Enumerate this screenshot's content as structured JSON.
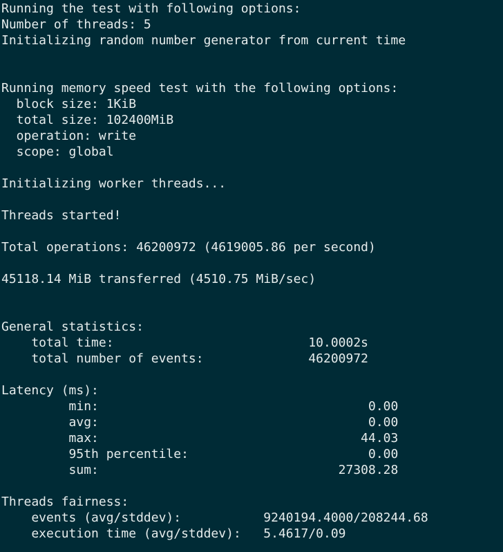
{
  "terminal": {
    "lines": [
      "Running the test with following options:",
      "Number of threads: 5",
      "Initializing random number generator from current time",
      "",
      "",
      "Running memory speed test with the following options:",
      "  block size: 1KiB",
      "  total size: 102400MiB",
      "  operation: write",
      "  scope: global",
      "",
      "Initializing worker threads...",
      "",
      "Threads started!",
      "",
      "Total operations: 46200972 (4619005.86 per second)",
      "",
      "45118.14 MiB transferred (4510.75 MiB/sec)",
      "",
      "",
      "General statistics:",
      "    total time:                          10.0002s",
      "    total number of events:              46200972",
      "",
      "Latency (ms):",
      "         min:                                    0.00",
      "         avg:                                    0.00",
      "         max:                                   44.03",
      "         95th percentile:                        0.00",
      "         sum:                                27308.28",
      "",
      "Threads fairness:",
      "    events (avg/stddev):           9240194.4000/208244.68",
      "    execution time (avg/stddev):   5.4617/0.09"
    ]
  }
}
